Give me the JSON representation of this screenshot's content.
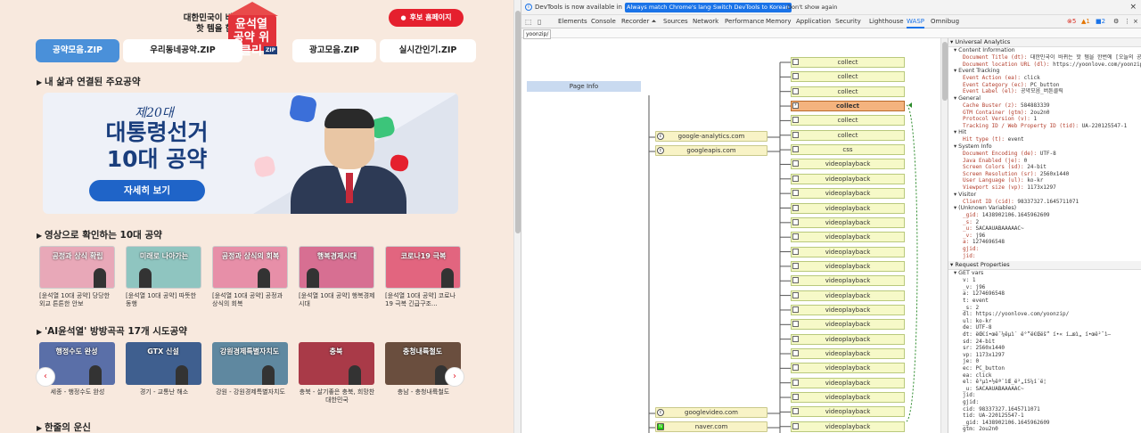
{
  "site": {
    "tagline_line1": "대한민국이 바뀌는",
    "tagline_line2": "핫 템을 한번에",
    "logo_text": "윤석열 공약 위클리",
    "logo_zip": "ZIP",
    "pledge_button": "후보 홈페이지",
    "tabs": [
      {
        "label": "공약모음.ZIP",
        "active": true
      },
      {
        "label": "우리동네공약.ZIP",
        "active": false
      },
      {
        "label": "광고모음.ZIP",
        "active": false
      },
      {
        "label": "실시간인기.ZIP",
        "active": false
      }
    ],
    "section1_title": "내 삶과 연결된 주요공약",
    "banner": {
      "line1": "제20대",
      "line2": "대통령선거",
      "line3": "10대 공약",
      "more": "자세히 보기"
    },
    "section2_title": "영상으로 확인하는 10대 공약",
    "videos": [
      {
        "thumb": "공정과 상식 확립",
        "caption": "[윤석열 10대 공약] 당당한 외교 튼튼한 안보"
      },
      {
        "thumb": "미래로 나아가는",
        "caption": "[윤석열 10대 공약] 따뜻한 동행"
      },
      {
        "thumb": "공정과 상식의 회복",
        "caption": "[윤석열 10대 공약] 공정과 상식의 회복"
      },
      {
        "thumb": "행복경제시대",
        "caption": "[윤석열 10대 공약] 행복경제시대"
      },
      {
        "thumb": "코로나19 극복",
        "caption": "[윤석열 10대 공약] 코로나19 극복 긴급구조..."
      }
    ],
    "section3_title": "'AI윤석열' 방방곡곡 17개 시도공약",
    "regions": [
      {
        "thumb": "행정수도 완성",
        "caption": "세종 - 행정수도 완성"
      },
      {
        "thumb": "GTX 신설",
        "caption": "경기 - 교통난 해소"
      },
      {
        "thumb": "강원경제특별자치도",
        "caption": "강원 - 강원경제특별자치도"
      },
      {
        "thumb": "충북",
        "caption": "충북 - 살기좋은 충북, 희망찬 대한민국"
      },
      {
        "thumb": "충청내륙철도",
        "caption": "충남 - 충청내륙철도"
      }
    ],
    "section4_title": "한줄의 운신"
  },
  "devtools": {
    "infobar": {
      "message": "DevTools is now available in Korean!",
      "btn1": "Always match Chrome's language",
      "btn2": "Switch DevTools to Korean",
      "btn3": "Don't show again"
    },
    "tabs": [
      "Elements",
      "Console",
      "Recorder ⏶",
      "Sources",
      "Network",
      "Performance",
      "Memory",
      "Application",
      "Security",
      "Lighthouse",
      "WASP",
      "Omnibug"
    ],
    "active_tab": "WASP",
    "errors": "5",
    "warnings": "1",
    "issues": "2",
    "breadcrumb": "yoonzip/",
    "page_info": "Page Info",
    "domains": [
      {
        "name": "google-analytics.com",
        "icon": "c"
      },
      {
        "name": "googleapis.com",
        "icon": "c"
      },
      {
        "name": "googlevideo.com",
        "icon": "c"
      },
      {
        "name": "naver.com",
        "icon": "N"
      }
    ],
    "requests": [
      "collect",
      "collect",
      "collect",
      "collect",
      "collect",
      "collect",
      "css",
      "videoplayback",
      "videoplayback",
      "videoplayback",
      "videoplayback",
      "videoplayback",
      "videoplayback",
      "videoplayback",
      "videoplayback",
      "videoplayback",
      "videoplayback",
      "videoplayback",
      "videoplayback",
      "videoplayback",
      "videoplayback",
      "videoplayback",
      "videoplayback",
      "videoplayback",
      "videoplayback",
      "videoplayback",
      "m"
    ],
    "selected_index": 3,
    "panel": {
      "title": "Universal Analytics",
      "sections": [
        {
          "name": "Content Information",
          "lines": [
            [
              "Document Title (dt):",
              "대한민국이 바뀌는 핫 템을 한번에 [오늘의 공약]"
            ],
            [
              "Document location URL (dl):",
              "https://yoonlove.com/yoonzip/"
            ]
          ]
        },
        {
          "name": "Event Tracking",
          "lines": [
            [
              "Event Action (ea):",
              "click"
            ],
            [
              "Event Category (ec):",
              "PC_button"
            ],
            [
              "Event Label (el):",
              "공약모음_버튼클릭"
            ]
          ]
        },
        {
          "name": "General",
          "lines": [
            [
              "Cache Buster (z):",
              "584883339"
            ],
            [
              "GTM Container (gtm):",
              "2ou2n0"
            ],
            [
              "Protocol Version (v):",
              "1"
            ],
            [
              "Tracking ID / Web Property ID (tid):",
              "UA-220125547-1"
            ]
          ]
        },
        {
          "name": "Hit",
          "lines": [
            [
              "Hit type (t):",
              "event"
            ]
          ]
        },
        {
          "name": "System Info",
          "lines": [
            [
              "Document Encoding (de):",
              "UTF-8"
            ],
            [
              "Java Enabled (je):",
              "0"
            ],
            [
              "Screen Colors (sd):",
              "24-bit"
            ],
            [
              "Screen Resolution (sr):",
              "2560x1440"
            ],
            [
              "User Language (ul):",
              "ko-kr"
            ],
            [
              "Viewport size (vp):",
              "1173x1297"
            ]
          ]
        },
        {
          "name": "Visitor",
          "lines": [
            [
              "Client ID (cid):",
              "98337327.1645711071"
            ]
          ]
        },
        {
          "name": "(Unknown Variables)",
          "lines": [
            [
              "_gid:",
              "1438902106.1645962609"
            ],
            [
              "_s:",
              "2"
            ],
            [
              "_u:",
              "SACAAUABAAAAAC~"
            ],
            [
              "_v:",
              "j96"
            ],
            [
              "a:",
              "1274696548"
            ],
            [
              "gjid:",
              ""
            ],
            [
              "jid:",
              ""
            ]
          ]
        }
      ],
      "request_title": "Request Properties",
      "get_title": "GET vars",
      "get_lines": [
        [
          "v:",
          "1"
        ],
        [
          "_v:",
          "j96"
        ],
        [
          "a:",
          "1274696548"
        ],
        [
          "t:",
          "event"
        ],
        [
          "_s:",
          "2"
        ],
        [
          "dl:",
          "https://yoonlove.com/yoonzip/"
        ],
        [
          "ul:",
          "ko-kr"
        ],
        [
          "de:",
          "UTF-8"
        ],
        [
          "dt:",
          "ëŒ€í•œë¯¼êµ­ì´ ë°”ë€Œëš” í•« í…œì„ í•œë²ˆì—"
        ],
        [
          "sd:",
          "24-bit"
        ],
        [
          "sr:",
          "2560x1440"
        ],
        [
          "vp:",
          "1173x1297"
        ],
        [
          "je:",
          "0"
        ],
        [
          "ec:",
          "PC_button"
        ],
        [
          "ea:",
          "click"
        ],
        [
          "el:",
          "ê³µì•½ëª¨ìŒ_ë²„íŠ¼í´ë¦­"
        ],
        [
          "_u:",
          "SACAAUABAAAAAC~"
        ],
        [
          "jid:",
          ""
        ],
        [
          "gjid:",
          ""
        ],
        [
          "cid:",
          "98337327.1645711071"
        ],
        [
          "tid:",
          "UA-220125547-1"
        ],
        [
          "_gid:",
          "1438902106.1645962609"
        ],
        [
          "gtm:",
          "2ou2n0"
        ]
      ]
    }
  }
}
